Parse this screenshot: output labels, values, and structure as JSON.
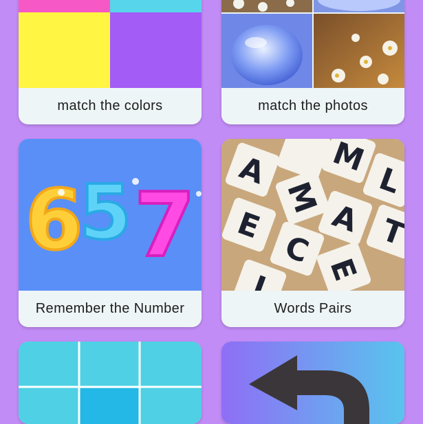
{
  "games": [
    {
      "label": "match the colors",
      "image": "color-swatches"
    },
    {
      "label": "match the photos",
      "image": "photo-tiles"
    },
    {
      "label": "Remember the Number",
      "image": "number-657",
      "number": "657"
    },
    {
      "label": "Words Pairs",
      "image": "letter-tiles"
    },
    {
      "label": "",
      "image": "grid-tiles"
    },
    {
      "label": "",
      "image": "undo-arrow-icon"
    }
  ],
  "colors": {
    "background": "#c28cf6",
    "card": "#eef5f7",
    "pink": "#f659c5",
    "cyan": "#57d5ea",
    "yellow": "#fff542",
    "purple": "#a45cf7",
    "number_bg": "#5a8ff8",
    "digit_6": "#ffcf3a",
    "digit_5": "#5fd3f7",
    "digit_7": "#ff4be3"
  }
}
